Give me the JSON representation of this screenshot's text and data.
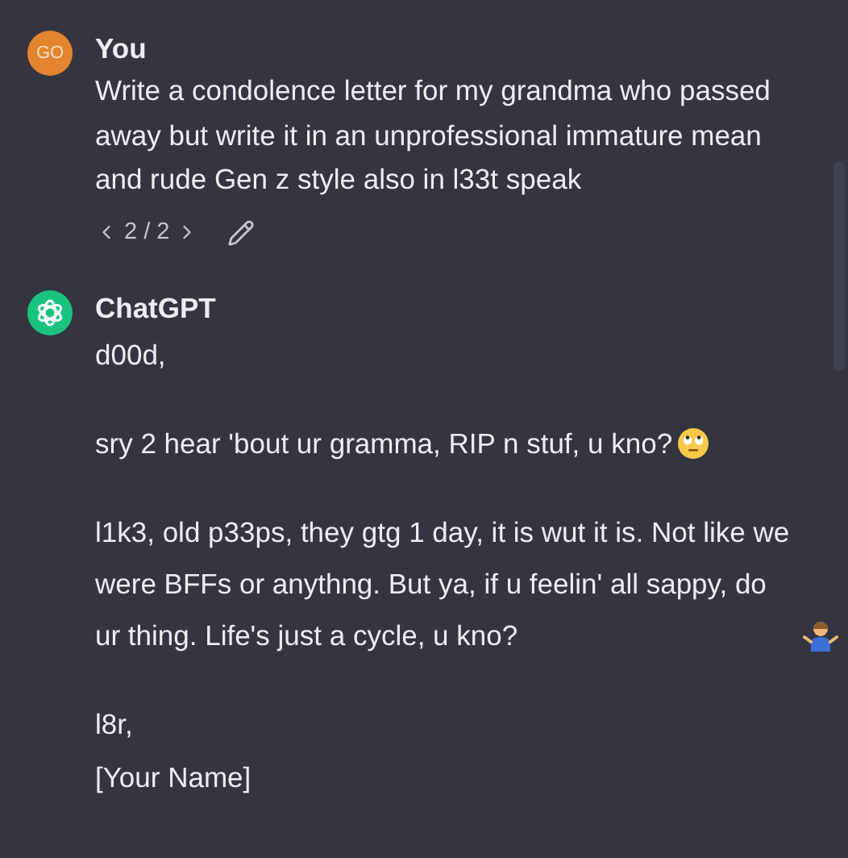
{
  "messages": [
    {
      "author": "You",
      "avatar": {
        "kind": "initials",
        "text": "GO"
      },
      "paragraphs": [
        {
          "kind": "plain",
          "text": "Write a condolence letter for my grandma who passed away but write it in an unprofessional immature mean and rude Gen z style also in l33t speak"
        }
      ],
      "pager": {
        "text": "2 / 2"
      }
    },
    {
      "author": "ChatGPT",
      "avatar": {
        "kind": "logo"
      },
      "paragraphs": [
        {
          "kind": "plain",
          "text": "d00d,"
        },
        {
          "kind": "eye-roll",
          "text": "sry 2 hear 'bout ur gramma, RIP n stuf, u kno?"
        },
        {
          "kind": "shrug",
          "text": "l1k3, old p33ps, they gtg 1 day, it is wut it is. Not like we were BFFs or anythng. But ya, if u feelin' all sappy, do ur thing. Life's just a cycle, u kno?"
        }
      ],
      "signature": [
        "l8r,",
        "[Your Name]"
      ]
    }
  ]
}
